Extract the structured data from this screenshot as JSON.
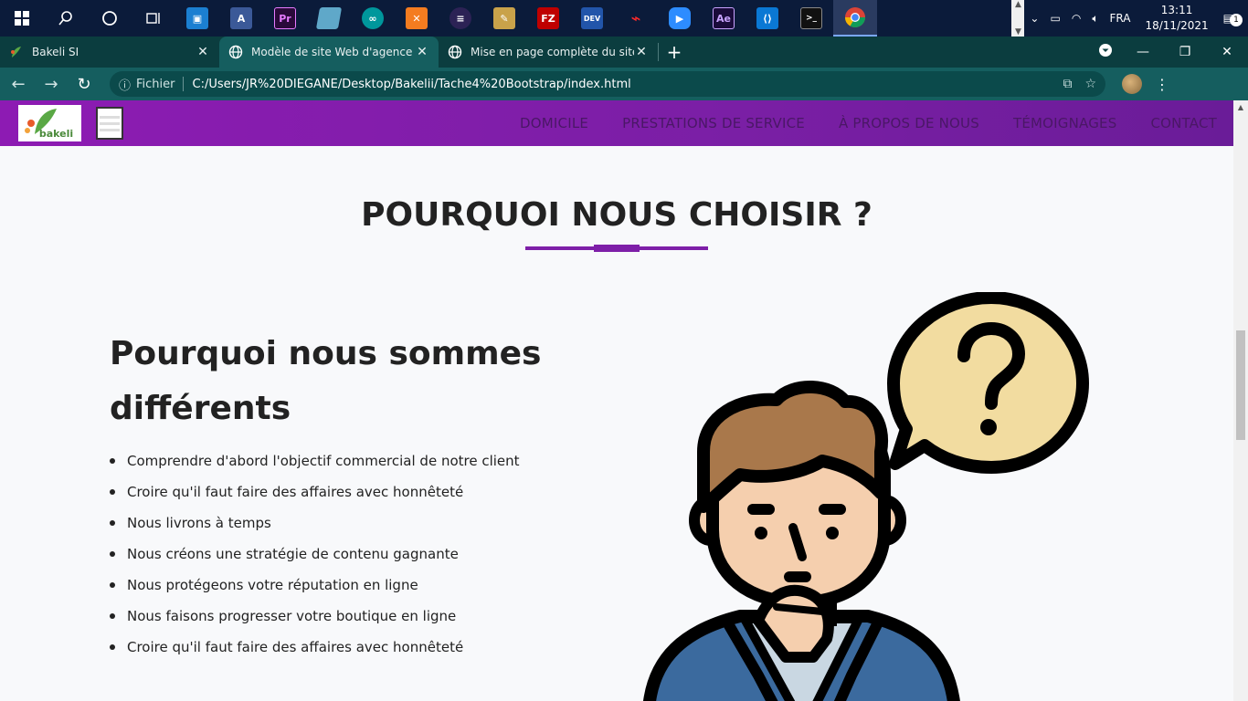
{
  "taskbar": {
    "apps": [
      {
        "name": "windows-start",
        "label": ""
      },
      {
        "name": "search",
        "label": ""
      },
      {
        "name": "cortana",
        "label": ""
      },
      {
        "name": "task-view",
        "label": ""
      },
      {
        "name": "app1",
        "label": ""
      },
      {
        "name": "app2",
        "label": "A"
      },
      {
        "name": "premiere",
        "label": "Pr"
      },
      {
        "name": "app4",
        "label": ""
      },
      {
        "name": "arduino",
        "label": ""
      },
      {
        "name": "xampp",
        "label": ""
      },
      {
        "name": "eclipse",
        "label": ""
      },
      {
        "name": "app8",
        "label": ""
      },
      {
        "name": "filezilla",
        "label": "FZ"
      },
      {
        "name": "devc",
        "label": "DEV"
      },
      {
        "name": "acrobat",
        "label": ""
      },
      {
        "name": "zoom",
        "label": ""
      },
      {
        "name": "after-effects",
        "label": "Ae"
      },
      {
        "name": "vscode",
        "label": ""
      },
      {
        "name": "terminal",
        "label": ""
      },
      {
        "name": "chrome",
        "label": ""
      }
    ],
    "language": "FRA",
    "time": "13:11",
    "date": "18/11/2021",
    "notification_count": "1"
  },
  "browser": {
    "tabs": [
      {
        "title": "Bakeli SI",
        "active": false
      },
      {
        "title": "Modèle de site Web d'agence - T",
        "active": true
      },
      {
        "title": "Mise en page complète du site W",
        "active": false
      }
    ],
    "address_scheme": "Fichier",
    "address_url": "C:/Users/JR%20DIEGANE/Desktop/Bakelii/Tache4%20Bootstrap/index.html"
  },
  "site": {
    "logo_text": "bakeli",
    "nav": [
      "DOMICILE",
      "PRESTATIONS DE SERVICE",
      "À PROPOS DE NOUS",
      "TÉMOIGNAGES",
      "CONTACT"
    ],
    "section_title": "POURQUOI NOUS CHOISIR ?",
    "heading": "Pourquoi nous sommes différents",
    "features": [
      "Comprendre d'abord l'objectif commercial de notre client",
      "Croire qu'il faut faire des affaires avec honnêteté",
      "Nous livrons à temps",
      "Nous créons une stratégie de contenu gagnante",
      "Nous protégeons votre réputation en ligne",
      "Nous faisons progresser votre boutique en ligne",
      "Croire qu'il faut faire des affaires avec honnêteté"
    ]
  },
  "colors": {
    "taskbar": "#0b1b3a",
    "tabstrip": "#0b3d3f",
    "toolbar": "#155e5f",
    "nav_purple": "#8d1bb3",
    "accent": "#7e1fa8"
  }
}
